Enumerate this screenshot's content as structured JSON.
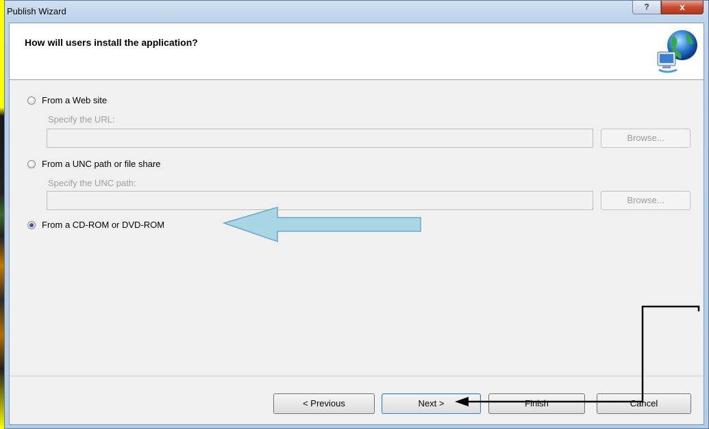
{
  "window": {
    "title": "Publish Wizard",
    "help_label": "?",
    "close_label": "x"
  },
  "header": {
    "title": "How will users install the application?"
  },
  "options": {
    "web": {
      "label": "From a Web site",
      "sub_label": "Specify the URL:",
      "input_value": "",
      "browse_label": "Browse...",
      "checked": false,
      "enabled": false
    },
    "unc": {
      "label": "From a UNC path or file share",
      "sub_label": "Specify the UNC path:",
      "input_value": "",
      "browse_label": "Browse...",
      "checked": false,
      "enabled": false
    },
    "cd": {
      "label": "From a CD-ROM or DVD-ROM",
      "checked": true
    }
  },
  "buttons": {
    "previous": "< Previous",
    "next": "Next >",
    "finish": "Finish",
    "cancel": "Cancel"
  },
  "colors": {
    "background_highlight": "#ffff00",
    "annotation_arrow": "#a9d6e5",
    "accent": "#3c7fb1"
  },
  "icons": {
    "header_icon": "globe-network-icon"
  }
}
